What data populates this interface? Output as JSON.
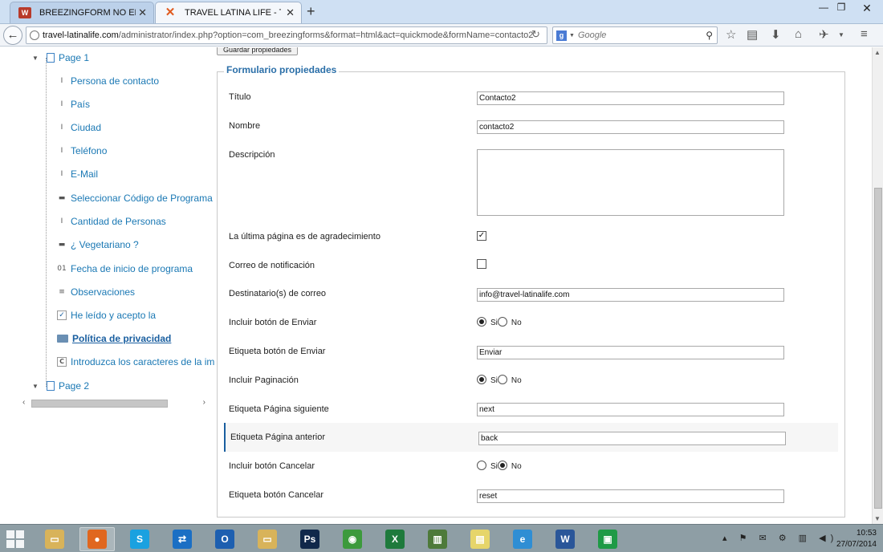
{
  "browser": {
    "tabs": [
      {
        "label": "BREEZINGFORM NO ENVIA...",
        "favicon": "W"
      },
      {
        "label": "TRAVEL LATINA LIFE - TO...",
        "favicon": "✕"
      }
    ],
    "new_tab": "+",
    "url_host": "travel-latinalife.com",
    "url_path": "/administrator/index.php?option=com_breezingforms&format=html&act=quickmode&formName=contacto2",
    "search_engine_badge": "g",
    "search_placeholder": "Google"
  },
  "tree": {
    "page1_label": "Page 1",
    "page2_label": "Page 2",
    "items": [
      {
        "label": "Persona de contacto",
        "icon": "text-field-icon",
        "glyph": "I"
      },
      {
        "label": "País",
        "icon": "text-field-icon",
        "glyph": "I"
      },
      {
        "label": "Ciudad",
        "icon": "text-field-icon",
        "glyph": "I"
      },
      {
        "label": "Teléfono",
        "icon": "text-field-icon",
        "glyph": "I"
      },
      {
        "label": "E-Mail",
        "icon": "text-field-icon",
        "glyph": "I"
      },
      {
        "label": "Seleccionar Código de Programa",
        "icon": "select-list-icon",
        "glyph": "▬"
      },
      {
        "label": "Cantidad de Personas",
        "icon": "text-field-icon",
        "glyph": "I"
      },
      {
        "label": "¿ Vegetariano ?",
        "icon": "select-list-icon",
        "glyph": "▬"
      },
      {
        "label": "Fecha de inicio de programa",
        "icon": "calendar-icon",
        "glyph": "01"
      },
      {
        "label": "Observaciones",
        "icon": "textarea-icon",
        "glyph": "≡"
      },
      {
        "label": "He leído y acepto la",
        "icon": "checkbox-icon",
        "glyph": "✓"
      },
      {
        "label": "Política de privacidad",
        "icon": "folder-icon",
        "glyph": ""
      },
      {
        "label": "Introduzca los caracteres de la im",
        "icon": "captcha-icon",
        "glyph": "C"
      }
    ]
  },
  "form": {
    "save_label": "Guardar propiedades",
    "legend": "Formulario propiedades",
    "titulo_label": "Título",
    "titulo_value": "Contacto2",
    "nombre_label": "Nombre",
    "nombre_value": "contacto2",
    "descripcion_label": "Descripción",
    "descripcion_value": "",
    "ultima_pagina_label": "La última página es de agradecimiento",
    "ultima_pagina_checked": true,
    "correo_notif_label": "Correo de notificación",
    "correo_notif_checked": false,
    "destinatarios_label": "Destinatario(s) de correo",
    "destinatarios_value": "info@travel-latinalife.com",
    "incluir_enviar_label": "Incluir botón de Enviar",
    "incluir_enviar_selected": "Si",
    "etiqueta_enviar_label": "Etiqueta botón de Enviar",
    "etiqueta_enviar_value": "Enviar",
    "incluir_paginacion_label": "Incluir Paginación",
    "incluir_paginacion_selected": "Si",
    "pag_siguiente_label": "Etiqueta Página siguiente",
    "pag_siguiente_value": "next",
    "pag_anterior_label": "Etiqueta Página anterior",
    "pag_anterior_value": "back",
    "incluir_cancelar_label": "Incluir botón Cancelar",
    "incluir_cancelar_selected": "No",
    "etiqueta_cancelar_label": "Etiqueta botón Cancelar",
    "etiqueta_cancelar_value": "reset",
    "si_label": "Si",
    "no_label": "No"
  },
  "taskbar": {
    "time": "10:53",
    "date": "27/07/2014",
    "apps": [
      {
        "name": "file-explorer",
        "glyph": "▭",
        "color": "#d8b35a"
      },
      {
        "name": "firefox",
        "glyph": "●",
        "color": "#e0671f"
      },
      {
        "name": "skype",
        "glyph": "S",
        "color": "#1aa1e0"
      },
      {
        "name": "teamviewer",
        "glyph": "⇄",
        "color": "#1b6fc4"
      },
      {
        "name": "outlook",
        "glyph": "O",
        "color": "#1d5fb0"
      },
      {
        "name": "folder",
        "glyph": "▭",
        "color": "#d8b35a"
      },
      {
        "name": "photoshop",
        "glyph": "Ps",
        "color": "#10284a"
      },
      {
        "name": "chrome",
        "glyph": "◉",
        "color": "#3c9a3c"
      },
      {
        "name": "excel",
        "glyph": "X",
        "color": "#1e7a3c"
      },
      {
        "name": "charts-app",
        "glyph": "▥",
        "color": "#4e7a3a"
      },
      {
        "name": "sticky-notes",
        "glyph": "▤",
        "color": "#e6d56a"
      },
      {
        "name": "internet-explorer",
        "glyph": "e",
        "color": "#2f8ed4"
      },
      {
        "name": "word",
        "glyph": "W",
        "color": "#2a5699"
      },
      {
        "name": "store",
        "glyph": "▣",
        "color": "#1f9a46"
      }
    ]
  }
}
